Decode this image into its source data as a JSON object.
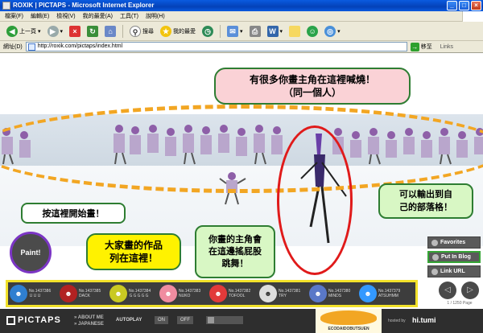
{
  "window": {
    "title": "ROXIK | PICTAPS - Microsoft Internet Explorer"
  },
  "menu": [
    "檔案(F)",
    "編輯(E)",
    "檢視(V)",
    "我的最愛(A)",
    "工具(T)",
    "說明(H)"
  ],
  "toolbar": {
    "back": "上一頁",
    "search": "搜尋",
    "favorites": "我的最愛"
  },
  "address": {
    "label": "網址(D)",
    "url": "http://roxik.com/pictaps/index.html",
    "go": "移至",
    "links": "Links"
  },
  "bubbles": {
    "top_line1": "有很多你畫主角在這裡喊燒！",
    "top_line2": "（同一個人）",
    "paint_hint": "按這裡開始畫！",
    "gallery_line1": "大家畫的作品",
    "gallery_line2": "列在這裡！",
    "dance_line1": "你畫的主角會",
    "dance_line2": "在這邊搖屁股",
    "dance_line3": "跳舞！",
    "blog_line1": "可以輸出到自",
    "blog_line2": "己的部落格！"
  },
  "paint_button": "Paint!",
  "side": {
    "favorites": "Favorites",
    "blog": "Put In Blog",
    "link": "Link URL"
  },
  "gallery": [
    {
      "no": "No.1437386",
      "name": "ＵＵＵ",
      "color": "#2F7FD0"
    },
    {
      "no": "No.1437385",
      "name": "DACK",
      "color": "#B22222"
    },
    {
      "no": "No.1437384",
      "name": "ＧＧＧＧＧ",
      "color": "#C9C922"
    },
    {
      "no": "No.1437383",
      "name": "NUKO",
      "color": "#F08CA0"
    },
    {
      "no": "No.1437382",
      "name": "TOFOOL",
      "color": "#E23A3A"
    },
    {
      "no": "No.1437381",
      "name": "TRY",
      "color": "#DDDDDD"
    },
    {
      "no": "No.1437380",
      "name": "MINDS",
      "color": "#5A78C8"
    },
    {
      "no": "No.1437379",
      "name": "ATSUHMM",
      "color": "#3399FF"
    }
  ],
  "pager": {
    "count": "1 / 1250 Page"
  },
  "footer": {
    "logo": "PICTAPS",
    "about": "» ABOUT ME",
    "japanese": "» JAPANESE",
    "autoplay": "AUTOPLAY",
    "on": "ON",
    "off": "OFF",
    "banner": "ECODAIDOBUTSUEN",
    "hosted": "hosted by",
    "host": "hi.tumi"
  }
}
